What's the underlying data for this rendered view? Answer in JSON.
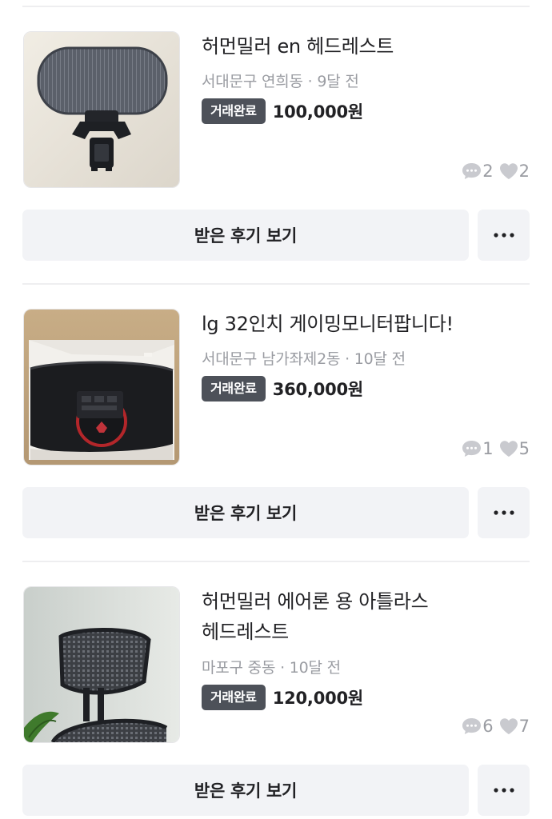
{
  "listings": [
    {
      "title_line1": "허먼밀러 en 헤드레스트",
      "title_line2": "",
      "location": "서대문구 연희동",
      "time": "9달 전",
      "status": "거래완료",
      "price": "100,000원",
      "chats": "2",
      "likes": "2",
      "review_label": "받은 후기 보기"
    },
    {
      "title_line1": "lg 32인치 게이밍모니터팝니다!",
      "title_line2": "",
      "location": "서대문구 남가좌제2동",
      "time": "10달 전",
      "status": "거래완료",
      "price": "360,000원",
      "chats": "1",
      "likes": "5",
      "review_label": "받은 후기 보기"
    },
    {
      "title_line1": "허먼밀러 에어론 용 아틀라스",
      "title_line2": "헤드레스트",
      "location": "마포구 중동",
      "time": "10달 전",
      "status": "거래완료",
      "price": "120,000원",
      "chats": "6",
      "likes": "7",
      "review_label": "받은 후기 보기"
    }
  ],
  "separator": "·",
  "icons": {
    "chat": "chat-bubble-icon",
    "like": "heart-icon",
    "more": "more-horizontal-icon"
  },
  "colors": {
    "badge_bg": "#4d5159",
    "button_bg": "#f2f3f6",
    "muted_text": "#9a9ca2"
  }
}
